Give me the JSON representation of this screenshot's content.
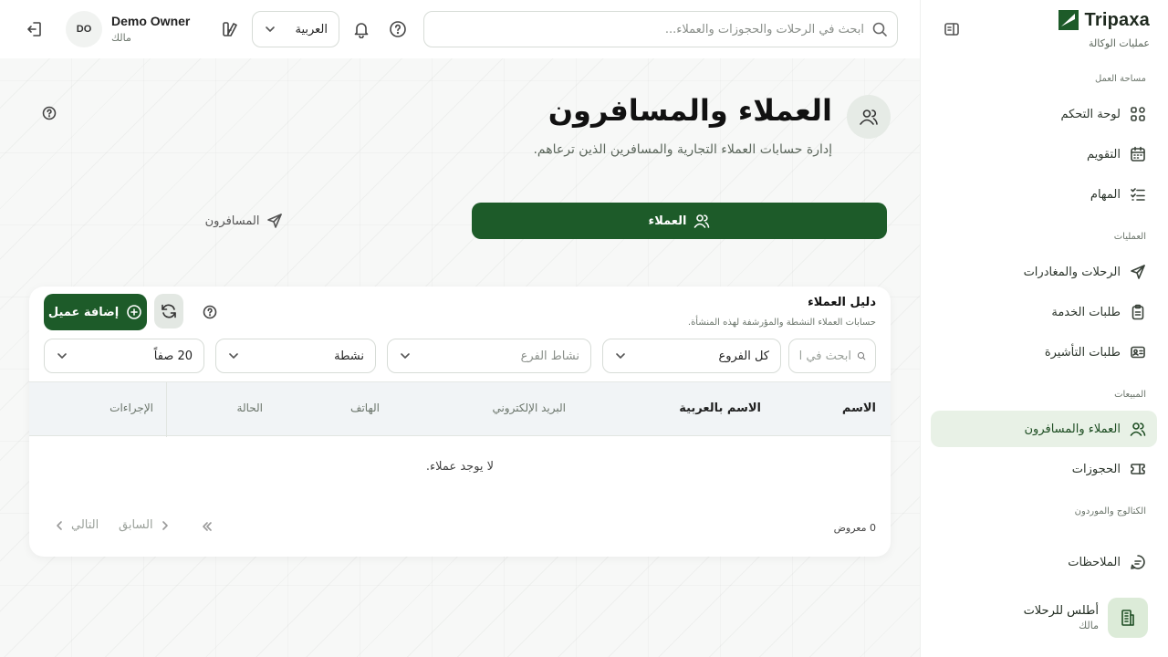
{
  "brand": {
    "name": "Tripaxa",
    "subtitle": "عمليات الوكالة"
  },
  "sidebar": {
    "sections": {
      "workspace": "مساحة العمل",
      "operations": "العمليات",
      "sales": "المبيعات",
      "catalog": "الكتالوج والموردون"
    },
    "items": [
      {
        "label": "لوحة التحكم",
        "icon": "dashboard-icon"
      },
      {
        "label": "التقويم",
        "icon": "calendar-icon"
      },
      {
        "label": "المهام",
        "icon": "tasks-icon"
      },
      {
        "label": "الرحلات والمغادرات",
        "icon": "paper-plane-icon"
      },
      {
        "label": "طلبات الخدمة",
        "icon": "clipboard-icon"
      },
      {
        "label": "طلبات التأشيرة",
        "icon": "id-card-icon"
      },
      {
        "label": "العملاء والمسافرون",
        "icon": "users-icon",
        "active": true
      },
      {
        "label": "الحجوزات",
        "icon": "ticket-icon"
      },
      {
        "label": "الملاحظات",
        "icon": "note-icon"
      }
    ],
    "org": {
      "name": "أطلس للرحلات",
      "role": "مالك"
    }
  },
  "topbar": {
    "search_placeholder": "ابحث في الرحلات والحجوزات والعملاء...",
    "language": "العربية",
    "user": {
      "name": "Demo Owner",
      "role": "مالك",
      "initials": "DO"
    }
  },
  "page": {
    "title": "العملاء والمسافرون",
    "subtitle": "إدارة حسابات العملاء التجارية والمسافرين الذين ترعاهم."
  },
  "tabs": {
    "clients": "العملاء",
    "travelers": "المسافرون"
  },
  "directory": {
    "title": "دليل العملاء",
    "subtitle": "حسابات العملاء النشطة والمؤرشفة لهذه المنشأة.",
    "add_button": "إضافة عميل",
    "filters": {
      "search_placeholder": "ابحث في ا",
      "branch": "كل الفروع",
      "activity_placeholder": "نشاط الفرع",
      "status": "نشطة",
      "rows": "20 صفاً"
    },
    "columns": {
      "name": "الاسم",
      "name_ar": "الاسم بالعربية",
      "email": "البريد الإلكتروني",
      "phone": "الهاتف",
      "status": "الحالة",
      "actions": "الإجراءات"
    },
    "empty": "لا يوجد عملاء.",
    "shown": "0 معروض",
    "pager": {
      "prev": "السابق",
      "next": "التالي"
    }
  },
  "colors": {
    "brand": "#1d5b29",
    "active_bg": "#e8f1e6"
  }
}
